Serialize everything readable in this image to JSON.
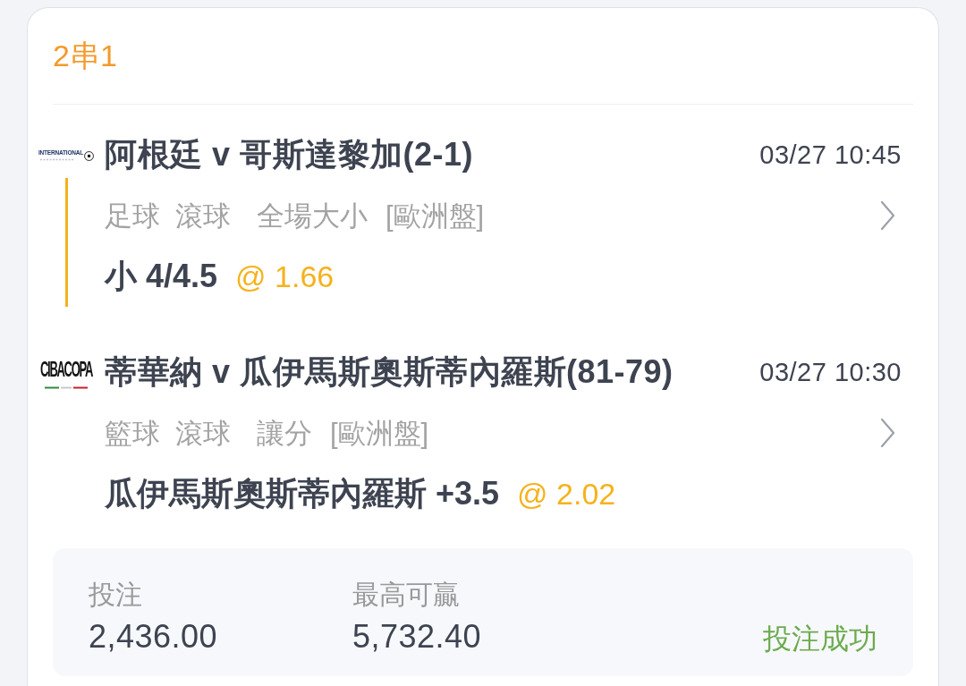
{
  "bet_type": "2串1",
  "legs": [
    {
      "logo": {
        "kind": "soccer",
        "text": "INTERNATIONAL"
      },
      "match": "阿根廷 v 哥斯達黎加(2-1)",
      "time": "03/27 10:45",
      "sport": "足球",
      "mode": "滾球",
      "market": "全場大小",
      "odds_format": "[歐洲盤]",
      "selection": "小 4/4.5",
      "odds": "@ 1.66"
    },
    {
      "logo": {
        "kind": "basketball",
        "text": "CIBACOPA"
      },
      "match": "蒂華納 v 瓜伊馬斯奧斯蒂內羅斯(81-79)",
      "time": "03/27 10:30",
      "sport": "籃球",
      "mode": "滾球",
      "market": "讓分",
      "odds_format": "[歐洲盤]",
      "selection": "瓜伊馬斯奧斯蒂內羅斯 +3.5",
      "odds": "@ 2.02"
    }
  ],
  "summary": {
    "stake_label": "投注",
    "stake": "2,436.00",
    "max_win_label": "最高可贏",
    "max_win": "5,732.40",
    "status": "投注成功"
  }
}
